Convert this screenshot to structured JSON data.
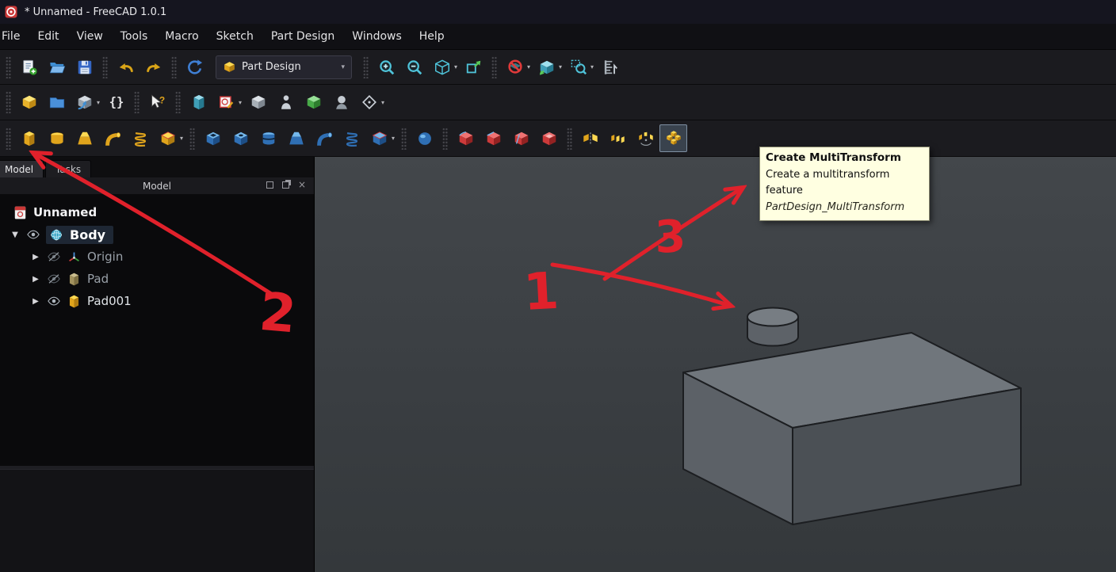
{
  "window": {
    "title": "* Unnamed - FreeCAD 1.0.1"
  },
  "menu": {
    "items": [
      "File",
      "Edit",
      "View",
      "Tools",
      "Macro",
      "Sketch",
      "Part Design",
      "Windows",
      "Help"
    ]
  },
  "toolbars": {
    "workbench_selector": {
      "value": "Part Design"
    },
    "row1_icons": [
      "new-document",
      "open",
      "save",
      "undo",
      "redo",
      "refresh",
      "zoom-in",
      "zoom-out",
      "axonometric-view",
      "sync-view",
      "clipping-plane",
      "view-cube",
      "zoom-region",
      "measure"
    ],
    "row2_icons": [
      "create-part",
      "create-group",
      "make-link",
      "variable-set",
      "whats-this",
      "create-body",
      "create-sketch",
      "validate-sketch",
      "check-geometry",
      "subshape-binder",
      "clone",
      "create-datum"
    ],
    "row3_icons": [
      "pad",
      "revolution",
      "additive-loft",
      "additive-pipe",
      "additive-helix",
      "additive-primitive",
      "pocket",
      "hole",
      "groove",
      "subtractive-loft",
      "subtractive-pipe",
      "subtractive-helix",
      "subtractive-primitive",
      "boolean-operation",
      "fillet",
      "chamfer",
      "draft",
      "thickness",
      "mirrored",
      "linear-pattern",
      "polar-pattern",
      "multitransform"
    ]
  },
  "tooltip": {
    "title": "Create MultiTransform",
    "description": "Create a multitransform feature",
    "command": "PartDesign_MultiTransform"
  },
  "dock": {
    "tabs": [
      "Model",
      "Tasks"
    ],
    "panel_title": "Model",
    "tree": [
      {
        "label": "Unnamed"
      },
      {
        "label": "Body"
      },
      {
        "label": "Origin"
      },
      {
        "label": "Pad"
      },
      {
        "label": "Pad001"
      }
    ]
  },
  "annotations": {
    "numbers": [
      "1",
      "2",
      "3"
    ],
    "color": "#e0212b"
  },
  "colors": {
    "tooltip_bg": "#ffffe1",
    "viewport_bg": "#3a3e42",
    "annotation_red": "#e0212b"
  }
}
